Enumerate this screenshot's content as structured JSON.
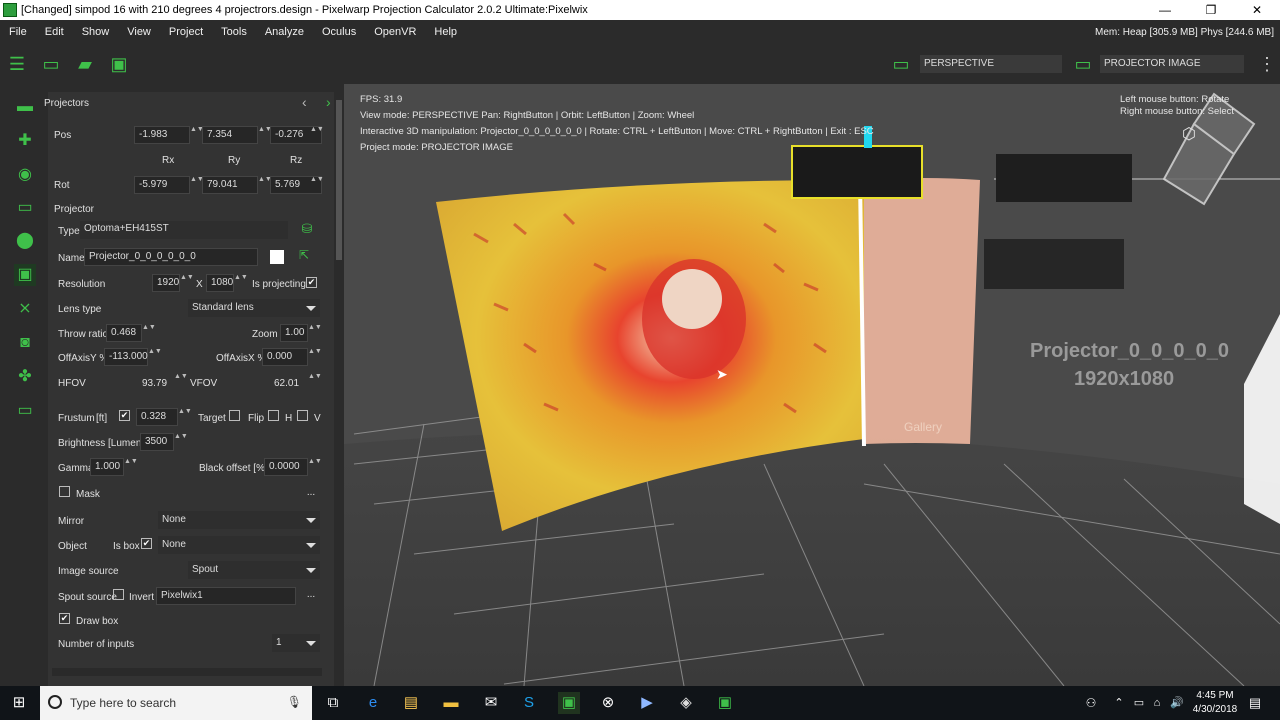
{
  "window": {
    "title": "[Changed] simpod 16 with 210 degrees 4 projectrors.design - Pixelwarp Projection Calculator 2.0.2 Ultimate:Pixelwix",
    "minimize": "—",
    "maximize": "❐",
    "close": "✕"
  },
  "menu": {
    "items": [
      "File",
      "Edit",
      "Show",
      "View",
      "Project",
      "Tools",
      "Analyze",
      "Oculus",
      "OpenVR",
      "Help"
    ],
    "memory": "Mem: Heap [305.9 MB] Phys [244.6 MB]"
  },
  "toolbar": {
    "view_left": "PERSPECTIVE",
    "view_right": "PROJECTOR IMAGE"
  },
  "panel": {
    "header": "Projectors",
    "pos_label": "Pos",
    "pos": [
      "-1.983",
      "7.354",
      "-0.276"
    ],
    "rot_headers": [
      "Rx",
      "Ry",
      "Rz"
    ],
    "rot_label": "Rot",
    "rot": [
      "-5.979",
      "79.041",
      "5.769"
    ],
    "section": "Projector",
    "type_label": "Type",
    "type_value": "Optoma+EH415ST",
    "name_label": "Name",
    "name_value": "Projector_0_0_0_0_0_0",
    "resolution_label": "Resolution",
    "res_w": "1920",
    "res_x": "X",
    "res_h": "1080",
    "is_projecting": "Is projecting",
    "lens_type_label": "Lens type",
    "lens_type": "Standard lens",
    "throw_label": "Throw ratio",
    "throw": "0.468",
    "zoom_label": "Zoom",
    "zoom": "1.00",
    "offy_label": "OffAxisY %",
    "offy": "-113.000",
    "offx_label": "OffAxisX %",
    "offx": "0.000",
    "hfov_label": "HFOV",
    "hfov": "93.79",
    "vfov_label": "VFOV",
    "vfov": "62.01",
    "frustum_label": "Frustum",
    "frustum_unit": "[ft]",
    "frustum": "0.328",
    "target": "Target",
    "flip": "Flip",
    "h": "H",
    "v": "V",
    "brightness_label": "Brightness [Lumens]",
    "brightness": "3500",
    "gamma_label": "Gamma",
    "gamma": "1.000",
    "black_label": "Black offset [%]",
    "black": "0.0000",
    "mask_label": "Mask",
    "ellipsis": "...",
    "mirror_label": "Mirror",
    "mirror": "None",
    "object_label": "Object",
    "isbox": "Is box",
    "object": "None",
    "image_source_label": "Image source",
    "image_source": "Spout",
    "spout_label": "Spout source",
    "invert": "Invert",
    "spout": "Pixelwix1",
    "drawbox": "Draw box",
    "inputs_label": "Number of inputs",
    "inputs": "1"
  },
  "viewport": {
    "fps": "FPS: 31.9",
    "mode": "View mode: PERSPECTIVE Pan: RightButton | Orbit: LeftButton | Zoom: Wheel",
    "interactive": "Interactive 3D manipulation: Projector_0_0_0_0_0_0 | Rotate: CTRL + LeftButton | Move: CTRL + RightButton | Exit : ESC",
    "project_mode": "Project mode: PROJECTOR IMAGE",
    "hint1": "Left mouse button: Rotate",
    "hint2": "Right mouse button: Select",
    "proj_label": "Projector_0_0_0_0_0",
    "proj_res": "1920x1080",
    "gallery": "Gallery"
  },
  "taskbar": {
    "search_placeholder": "Type here to search",
    "time": "4:45 PM",
    "date": "4/30/2018"
  }
}
